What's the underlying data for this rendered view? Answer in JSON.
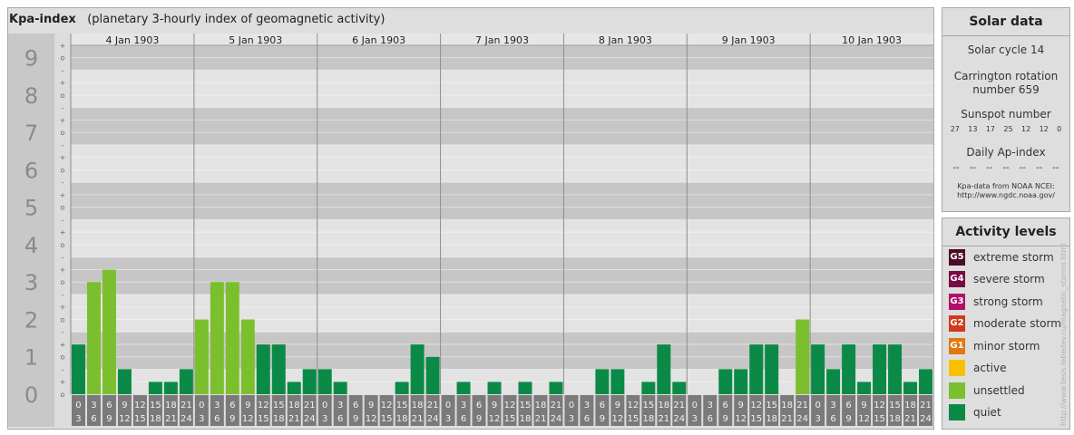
{
  "title": {
    "main": "Kpa-index",
    "sub": "(planetary 3-hourly index of geomagnetic activity)"
  },
  "chart_data": {
    "type": "bar",
    "days": [
      "4 Jan 1903",
      "5 Jan 1903",
      "6 Jan 1903",
      "7 Jan 1903",
      "8 Jan 1903",
      "9 Jan 1903",
      "10 Jan 1903"
    ],
    "interval_start_labels": [
      "0",
      "3",
      "6",
      "9",
      "12",
      "15",
      "18",
      "21"
    ],
    "interval_end_labels": [
      "3",
      "6",
      "9",
      "12",
      "15",
      "18",
      "21",
      "24"
    ],
    "y_tick_labels": [
      "0",
      "1",
      "2",
      "3",
      "4",
      "5",
      "6",
      "7",
      "8",
      "9"
    ],
    "sub_tick_labels": [
      "-",
      "o",
      "+"
    ],
    "ylim": [
      0,
      9.33
    ],
    "values": [
      [
        1.33,
        3,
        3.33,
        0.67,
        0,
        0.33,
        0.33,
        0.67
      ],
      [
        2,
        3,
        3,
        2,
        1.33,
        1.33,
        0.33,
        0.67
      ],
      [
        0.67,
        0.33,
        0,
        0,
        0,
        0.33,
        1.33,
        1
      ],
      [
        0,
        0.33,
        0,
        0.33,
        0,
        0.33,
        0,
        0.33
      ],
      [
        0,
        0,
        0.67,
        0.67,
        0,
        0.33,
        1.33,
        0.33
      ],
      [
        0,
        0,
        0.67,
        0.67,
        1.33,
        1.33,
        0,
        2
      ],
      [
        1.33,
        0.67,
        1.33,
        0.33,
        1.33,
        1.33,
        0.33,
        0.67
      ]
    ],
    "colors": {
      "quiet": "#0a8a46",
      "unsettled": "#7cbf2e"
    }
  },
  "solar": {
    "heading": "Solar data",
    "cycle": "Solar cycle 14",
    "carrington": "Carrington rotation number 659",
    "sunspot_title": "Sunspot number",
    "sunspot_values": [
      "27",
      "13",
      "17",
      "25",
      "12",
      "12",
      "0"
    ],
    "ap_title": "Daily Ap-index",
    "ap_values": [
      "--",
      "--",
      "--",
      "--",
      "--",
      "--",
      "--"
    ],
    "source_line1": "Kpa-data from NOAA NCEI:",
    "source_line2": "http://www.ngdc.noaa.gov/"
  },
  "activity": {
    "heading": "Activity levels",
    "items": [
      {
        "badge": "G5",
        "label": "extreme storm",
        "color": "#4a0a28"
      },
      {
        "badge": "G4",
        "label": "severe storm",
        "color": "#7a0a45"
      },
      {
        "badge": "G3",
        "label": "strong storm",
        "color": "#b0106a"
      },
      {
        "badge": "G2",
        "label": "moderate storm",
        "color": "#d03a1a"
      },
      {
        "badge": "G1",
        "label": "minor storm",
        "color": "#e07810"
      },
      {
        "badge": "",
        "label": "active",
        "color": "#f8c000"
      },
      {
        "badge": "",
        "label": "unsettled",
        "color": "#7cbf2e"
      },
      {
        "badge": "",
        "label": "quiet",
        "color": "#0a8a46"
      }
    ]
  },
  "watermark": "http://www.tesis.lebedev.ru/magnetic_storms.html"
}
